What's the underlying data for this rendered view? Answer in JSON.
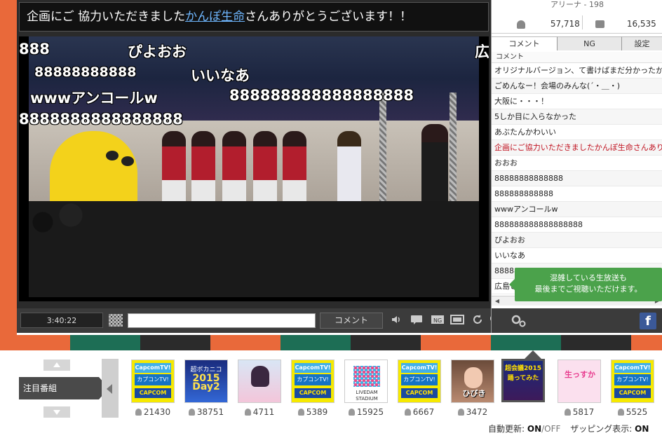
{
  "telop": {
    "prefix": "企画にご 協力いただきました",
    "sponsor": "かんぽ生命",
    "suffix": "さんありがとうございます！！"
  },
  "danmaku": [
    {
      "text": "888"
    },
    {
      "text": "ぴよおお"
    },
    {
      "text": "広"
    },
    {
      "text": "88888888888"
    },
    {
      "text": "いいなあ"
    },
    {
      "text": "wwwアンコールw"
    },
    {
      "text": "888888888888888888"
    },
    {
      "text": "8888888888888888"
    }
  ],
  "player": {
    "time": "3:40:22",
    "comment_placeholder": "",
    "comment_button": "コメント",
    "icons": [
      "volume-icon",
      "comment-toggle-icon",
      "ng-icon",
      "fullscreen-icon",
      "reload-icon",
      "app-icon",
      "settings-icon"
    ]
  },
  "stats": {
    "arena": "アリーナ - 198",
    "viewers": "57,718",
    "comments": "16,535"
  },
  "tabs": [
    "コメント",
    "NG",
    "設定"
  ],
  "comment_list": {
    "header": "コメント",
    "items": [
      {
        "text": "オリジナルバージョン、て書けばまだ分かったか",
        "highlight": false
      },
      {
        "text": "ごめんなー！会場のみんな(´・＿・)",
        "highlight": false
      },
      {
        "text": "大阪に・・・！",
        "highlight": false
      },
      {
        "text": "5しか目に入らなかった",
        "highlight": false
      },
      {
        "text": "あぶたんかわいい",
        "highlight": false
      },
      {
        "text": "企画にご協力いただきましたかんぽ生命さんあり",
        "highlight": true
      },
      {
        "text": "おおお",
        "highlight": false
      },
      {
        "text": "88888888888888",
        "highlight": false
      },
      {
        "text": "888888888888",
        "highlight": false
      },
      {
        "text": "wwwアンコールw",
        "highlight": false
      },
      {
        "text": "888888888888888888",
        "highlight": false
      },
      {
        "text": "ぴよおお",
        "highlight": false
      },
      {
        "text": "いいなあ",
        "highlight": false
      },
      {
        "text": "8888888",
        "highlight": false
      },
      {
        "text": "広島ときた",
        "highlight": false
      }
    ]
  },
  "congestion_popup": {
    "line1": "混雑している生放送も",
    "line2": "最後までご視聴いただけます。"
  },
  "facebook": {
    "label": "f"
  },
  "featured": {
    "label": "注目番組",
    "programs": [
      {
        "kind": "capcom",
        "top": "CapcomTV!",
        "mid": "カプコンTV!",
        "bot": "CAPCOM",
        "count": "21430"
      },
      {
        "kind": "voca",
        "line1": "超ボカニコ",
        "line2": "2015",
        "line3": "Day2",
        "count": "38751"
      },
      {
        "kind": "anime",
        "count": "4711"
      },
      {
        "kind": "capcom",
        "top": "CapcomTV!",
        "mid": "カプコンTV!",
        "bot": "CAPCOM",
        "count": "5389"
      },
      {
        "kind": "livedam",
        "lbl1": "LIVEDAM",
        "lbl2": "STADIUM",
        "count": "15925"
      },
      {
        "kind": "capcom",
        "top": "CapcomTV!",
        "mid": "カプコンTV!",
        "bot": "CAPCOM",
        "count": "6667"
      },
      {
        "kind": "idol",
        "name": "ひびき",
        "count": "3472"
      },
      {
        "kind": "odoru",
        "line1": "超会議2015",
        "line2": "踊ってみた",
        "count": ""
      },
      {
        "kind": "pink",
        "line1": "生っすか",
        "count": "5817"
      },
      {
        "kind": "capcom",
        "top": "CapcomTV!",
        "mid": "カプコンTV!",
        "bot": "CAPCOM",
        "count": "5525"
      }
    ]
  },
  "footer": {
    "auto_update_label": "自動更新:",
    "auto_on": "ON",
    "auto_sep": "/",
    "auto_off": "OFF",
    "zapping_label": "ザッピング表示:",
    "zapping_on": "ON"
  },
  "colors": {
    "orange": "#e9693a",
    "green": "#1d6e55",
    "dark": "#2b2b2b",
    "popup_green": "#4ba24b",
    "highlight_red": "#c0111f"
  }
}
